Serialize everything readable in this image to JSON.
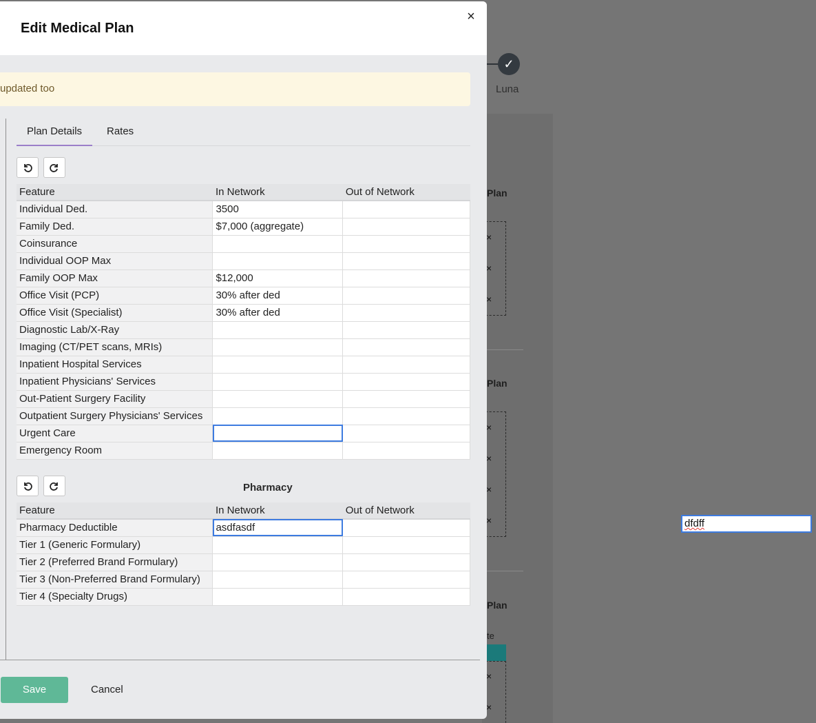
{
  "background": {
    "stepper_label": "Luna",
    "stepper_check": "✓",
    "plan_labels": [
      "Plan",
      "Plan",
      "Plan"
    ],
    "partial_text": "te",
    "remove_glyph": "×",
    "floating_input_value": "dfdff"
  },
  "modal": {
    "title": "Edit Medical Plan",
    "close_glyph": "×",
    "notice_text": "updated too",
    "tabs": [
      {
        "label": "Plan Details",
        "active": true
      },
      {
        "label": "Rates",
        "active": false
      }
    ],
    "medical_table": {
      "headers": [
        "Feature",
        "In Network",
        "Out of Network"
      ],
      "rows": [
        {
          "feature": "Individual Ded.",
          "in_network": "3500",
          "out_network": ""
        },
        {
          "feature": "Family Ded.",
          "in_network": "$7,000 (aggregate)",
          "out_network": ""
        },
        {
          "feature": "Coinsurance",
          "in_network": "",
          "out_network": ""
        },
        {
          "feature": "Individual OOP Max",
          "in_network": "",
          "out_network": ""
        },
        {
          "feature": "Family OOP Max",
          "in_network": "$12,000",
          "out_network": ""
        },
        {
          "feature": "Office Visit (PCP)",
          "in_network": "30% after ded",
          "out_network": ""
        },
        {
          "feature": "Office Visit (Specialist)",
          "in_network": "30% after ded",
          "out_network": ""
        },
        {
          "feature": "Diagnostic Lab/X-Ray",
          "in_network": "",
          "out_network": ""
        },
        {
          "feature": "Imaging (CT/PET scans, MRIs)",
          "in_network": "",
          "out_network": ""
        },
        {
          "feature": "Inpatient Hospital Services",
          "in_network": "",
          "out_network": ""
        },
        {
          "feature": "Inpatient Physicians' Services",
          "in_network": "",
          "out_network": ""
        },
        {
          "feature": "Out-Patient Surgery Facility",
          "in_network": "",
          "out_network": ""
        },
        {
          "feature": "Outpatient Surgery Physicians' Services",
          "in_network": "",
          "out_network": ""
        },
        {
          "feature": "Urgent Care",
          "in_network": "",
          "out_network": ""
        },
        {
          "feature": "Emergency Room",
          "in_network": "",
          "out_network": ""
        }
      ]
    },
    "pharmacy_title": "Pharmacy",
    "pharmacy_table": {
      "headers": [
        "Feature",
        "In Network",
        "Out of Network"
      ],
      "rows": [
        {
          "feature": "Pharmacy Deductible",
          "in_network": "asdfasdf",
          "out_network": ""
        },
        {
          "feature": "Tier 1 (Generic Formulary)",
          "in_network": "",
          "out_network": ""
        },
        {
          "feature": "Tier 2 (Preferred Brand Formulary)",
          "in_network": "",
          "out_network": ""
        },
        {
          "feature": "Tier 3 (Non-Preferred Brand Formulary)",
          "in_network": "",
          "out_network": ""
        },
        {
          "feature": "Tier 4 (Specialty Drugs)",
          "in_network": "",
          "out_network": ""
        }
      ]
    },
    "save_label": "Save",
    "cancel_label": "Cancel"
  },
  "colors": {
    "overlay": "#757575",
    "save_button": "#5fb897",
    "active_tab_underline": "#9b7fc9",
    "selected_cell_border": "#3d7be0",
    "notice_bg": "#fdf7e2"
  },
  "icons": {
    "undo": "undo-icon",
    "redo": "redo-icon",
    "close": "close-icon",
    "check": "check-icon"
  }
}
